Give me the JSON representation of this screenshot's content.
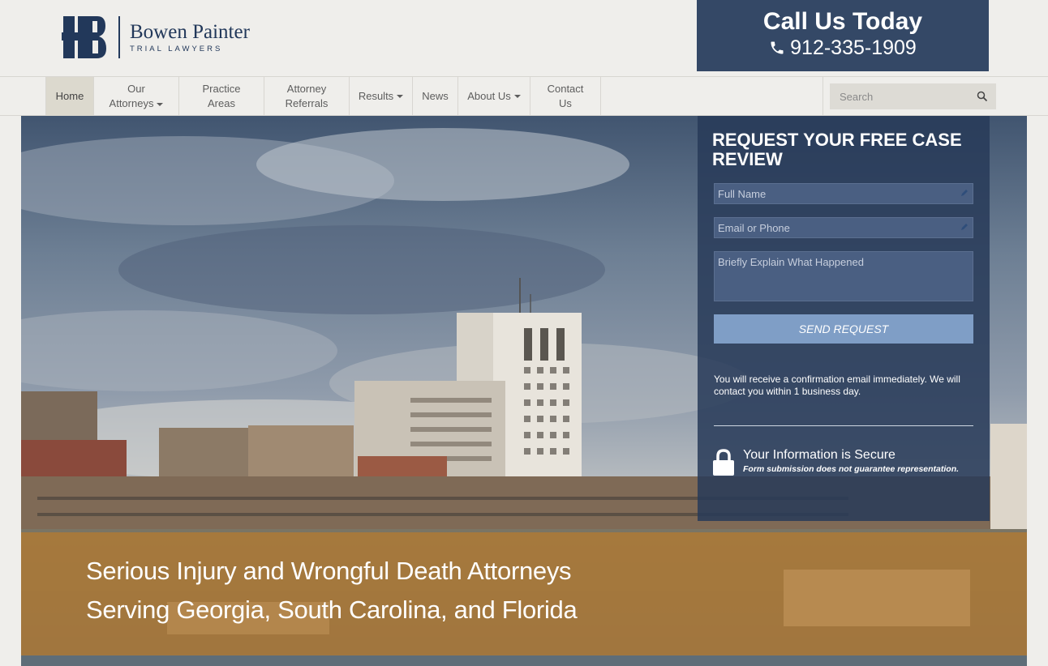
{
  "brand": {
    "name": "Bowen Painter",
    "subtitle": "TRIAL LAWYERS"
  },
  "callbox": {
    "title": "Call Us Today",
    "phone": "912-335-1909"
  },
  "nav": {
    "items": [
      {
        "label": "Home"
      },
      {
        "label_line1": "Our",
        "label_line2": "Attorneys"
      },
      {
        "label_line1": "Practice",
        "label_line2": "Areas"
      },
      {
        "label_line1": "Attorney",
        "label_line2": "Referrals"
      },
      {
        "label": "Results"
      },
      {
        "label": "News"
      },
      {
        "label": "About Us"
      },
      {
        "label": "Contact Us"
      }
    ],
    "search_placeholder": "Search"
  },
  "form": {
    "title": "REQUEST YOUR FREE CASE REVIEW",
    "name_placeholder": "Full Name",
    "contact_placeholder": "Email or Phone",
    "message_placeholder": "Briefly Explain What Happened",
    "submit_label": "SEND REQUEST",
    "confirmation": "You will receive a confirmation email immediately. We will contact you within 1 business day.",
    "secure_title": "Your Information is Secure",
    "secure_note": "Form submission does not guarantee representation."
  },
  "hero": {
    "line1": "Serious Injury and Wrongful Death Attorneys",
    "line2": "Serving Georgia, South Carolina, and Florida"
  },
  "colors": {
    "navy": "#344866",
    "brand_navy": "#22385a",
    "banner_gold": "#b07a34",
    "button_blue": "#7f9ec6",
    "nav_active": "#dcd9ce"
  }
}
